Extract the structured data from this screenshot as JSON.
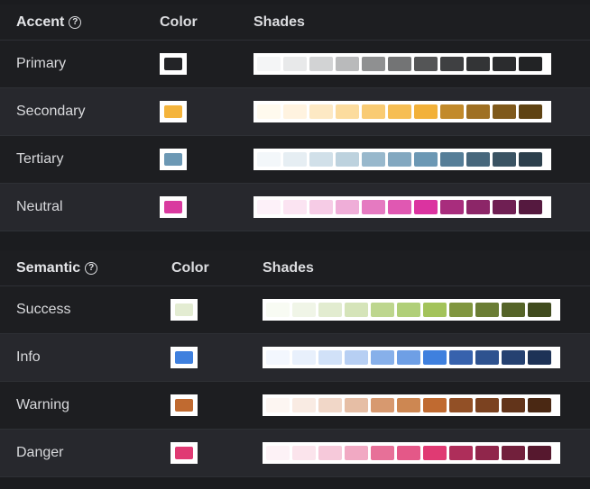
{
  "accent": {
    "title": "Accent",
    "color_header": "Color",
    "shades_header": "Shades",
    "rows": [
      {
        "label": "Primary",
        "color": "#232427",
        "shades": [
          "#f4f5f6",
          "#e8e9ea",
          "#d2d3d4",
          "#b9babb",
          "#8f9091",
          "#737475",
          "#545556",
          "#3f4042",
          "#333436",
          "#2b2c2e",
          "#222325"
        ]
      },
      {
        "label": "Secondary",
        "color": "#f4b43c",
        "shades": [
          "#fffaee",
          "#fff3e0",
          "#fde9c4",
          "#fcdc9e",
          "#f9cb73",
          "#f6be54",
          "#f2b13a",
          "#c28a2b",
          "#9f7023",
          "#7f591b",
          "#5f4313"
        ]
      },
      {
        "label": "Tertiary",
        "color": "#6c98b4",
        "shades": [
          "#f3f7fa",
          "#e6eef3",
          "#d1e0e9",
          "#bdd2de",
          "#98b8cc",
          "#83a8c0",
          "#6c98b4",
          "#567e98",
          "#47677c",
          "#3a5363",
          "#2c3f4c"
        ]
      },
      {
        "label": "Neutral",
        "color": "#d93a9f",
        "shades": [
          "#fdf1f9",
          "#fbe4f2",
          "#f6cce6",
          "#efaed8",
          "#e57ac1",
          "#e058b2",
          "#db33a0",
          "#a82d7d",
          "#8c2668",
          "#6f1f53",
          "#55193f"
        ]
      }
    ]
  },
  "semantic": {
    "title": "Semantic",
    "color_header": "Color",
    "shades_header": "Shades",
    "rows": [
      {
        "label": "Success",
        "color": "#e3ecd2",
        "shades": [
          "#f8fbf3",
          "#f0f5e7",
          "#e2ecd0",
          "#d5e4b9",
          "#bdd68e",
          "#b0cf78",
          "#a3c35a",
          "#80963f",
          "#6a7d34",
          "#556428",
          "#404b1e"
        ]
      },
      {
        "label": "Info",
        "color": "#3f80de",
        "shades": [
          "#f3f7fe",
          "#e8f0fc",
          "#d1e1f8",
          "#b7cff3",
          "#87b0ea",
          "#6e9fe5",
          "#3f80de",
          "#3762ad",
          "#2e528f",
          "#254171",
          "#1d3256"
        ]
      },
      {
        "label": "Warning",
        "color": "#c06a30",
        "shades": [
          "#fdf6f2",
          "#f9ebe3",
          "#f1d7c8",
          "#e6bea5",
          "#d7996f",
          "#cd8752",
          "#c06a30",
          "#925026",
          "#7b4220",
          "#62341a",
          "#4a2813"
        ]
      },
      {
        "label": "Danger",
        "color": "#e03a73",
        "shades": [
          "#fdf2f6",
          "#fbe4ec",
          "#f6c9da",
          "#f1a9c3",
          "#e77098",
          "#e45888",
          "#e03a73",
          "#ae2e5a",
          "#90264b",
          "#72203c",
          "#56182e"
        ]
      }
    ]
  }
}
